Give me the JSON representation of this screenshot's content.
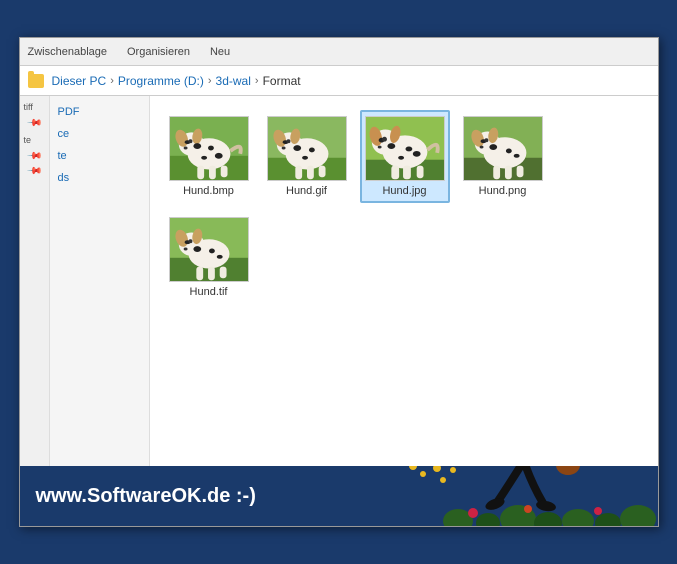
{
  "window": {
    "title": "Format"
  },
  "toolbar": {
    "items": [
      "Zwischenablage",
      "Organisieren",
      "Neu"
    ]
  },
  "breadcrumb": {
    "items": [
      "Dieser PC",
      "Programme (D:)",
      "3d-wal",
      "Format"
    ]
  },
  "sidebar": {
    "items": [
      {
        "label": "tiff",
        "pin": true
      },
      {
        "label": "te",
        "pin": true
      },
      {
        "label": "",
        "pin": true
      }
    ]
  },
  "left_panel": {
    "items": [
      "PDF",
      "ce",
      "te",
      "ds"
    ]
  },
  "files": [
    {
      "name": "Hund.bmp",
      "selected": false
    },
    {
      "name": "Hund.gif",
      "selected": false
    },
    {
      "name": "Hund.jpg",
      "selected": true
    },
    {
      "name": "Hund.png",
      "selected": false
    },
    {
      "name": "Hund.tif",
      "selected": false
    }
  ],
  "watermark": {
    "text": "www.SoftwareOK.de :-)"
  }
}
